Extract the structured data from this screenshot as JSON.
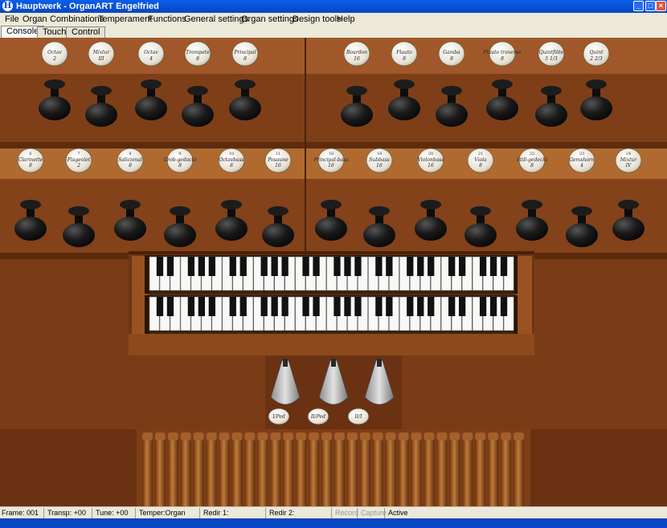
{
  "window": {
    "title": "Hauptwerk - OrganART Engelfried",
    "icon": "hauptwerk-logo-icon",
    "controls": [
      "minimize-icon",
      "maximize-icon",
      "close-icon"
    ]
  },
  "menu": [
    "File",
    "Organ",
    "Combinations",
    "Temperament",
    "Functions",
    "General settings",
    "Organ settings",
    "Design tools",
    "Help"
  ],
  "tabs": [
    {
      "label": "Console",
      "active": true
    },
    {
      "label": "Touch",
      "active": false
    },
    {
      "label": "Control",
      "active": false
    }
  ],
  "console": {
    "colors": {
      "wood": "#8B4A1E",
      "wood_dark": "#5E2E10",
      "wood_light": "#B0672C",
      "knob": "#141414",
      "plate": "#EEEAE0"
    },
    "stops_row1": [
      {
        "num": "",
        "name": "Octav",
        "pitch": "2"
      },
      {
        "num": "",
        "name": "Mixtur",
        "pitch": "III"
      },
      {
        "num": "",
        "name": "Octav",
        "pitch": "4"
      },
      {
        "num": "",
        "name": "Trompete",
        "pitch": "8"
      },
      {
        "num": "",
        "name": "Principal",
        "pitch": "8"
      },
      {
        "num": "",
        "name": "Bourdon",
        "pitch": "16"
      },
      {
        "num": "",
        "name": "Flauto",
        "pitch": "8"
      },
      {
        "num": "",
        "name": "Gamba",
        "pitch": "8"
      },
      {
        "num": "",
        "name": "Flauto traverso",
        "pitch": "8"
      },
      {
        "num": "",
        "name": "Quintflöte",
        "pitch": "5 1/3"
      },
      {
        "num": "",
        "name": "Quint",
        "pitch": "2 2/3"
      }
    ],
    "stops_row2": [
      {
        "num": "6",
        "name": "Clarinette",
        "pitch": "8"
      },
      {
        "num": "7",
        "name": "Flageolet",
        "pitch": "2"
      },
      {
        "num": "8",
        "name": "Salicional",
        "pitch": "8"
      },
      {
        "num": "9",
        "name": "Grob-gedackt",
        "pitch": "8"
      },
      {
        "num": "10",
        "name": "Octavbass",
        "pitch": "8"
      },
      {
        "num": "11",
        "name": "Posaune",
        "pitch": "16"
      },
      {
        "num": "18",
        "name": "Principal-bass",
        "pitch": "16"
      },
      {
        "num": "19",
        "name": "Subbass",
        "pitch": "16"
      },
      {
        "num": "20",
        "name": "Violonbass",
        "pitch": "16"
      },
      {
        "num": "21",
        "name": "Viola",
        "pitch": "8"
      },
      {
        "num": "22",
        "name": "Still-gedeckt",
        "pitch": "8"
      },
      {
        "num": "23",
        "name": "Gemshorn",
        "pitch": "4"
      },
      {
        "num": "24",
        "name": "Mixtur",
        "pitch": "IV"
      }
    ],
    "manuals": 2,
    "swell_pedals": 3,
    "pistons": [
      {
        "label": "I/Ped"
      },
      {
        "label": "II/Ped"
      },
      {
        "label": "II/I"
      }
    ]
  },
  "status": {
    "frame": "Frame: 001",
    "transp": "Transp: +00",
    "tune": "Tune: +00",
    "temper": "Temper:Organ",
    "redir1": "Redir 1:",
    "redir2": "Redir 2:",
    "record": "Record",
    "capture": "Capture",
    "active": "Active"
  }
}
